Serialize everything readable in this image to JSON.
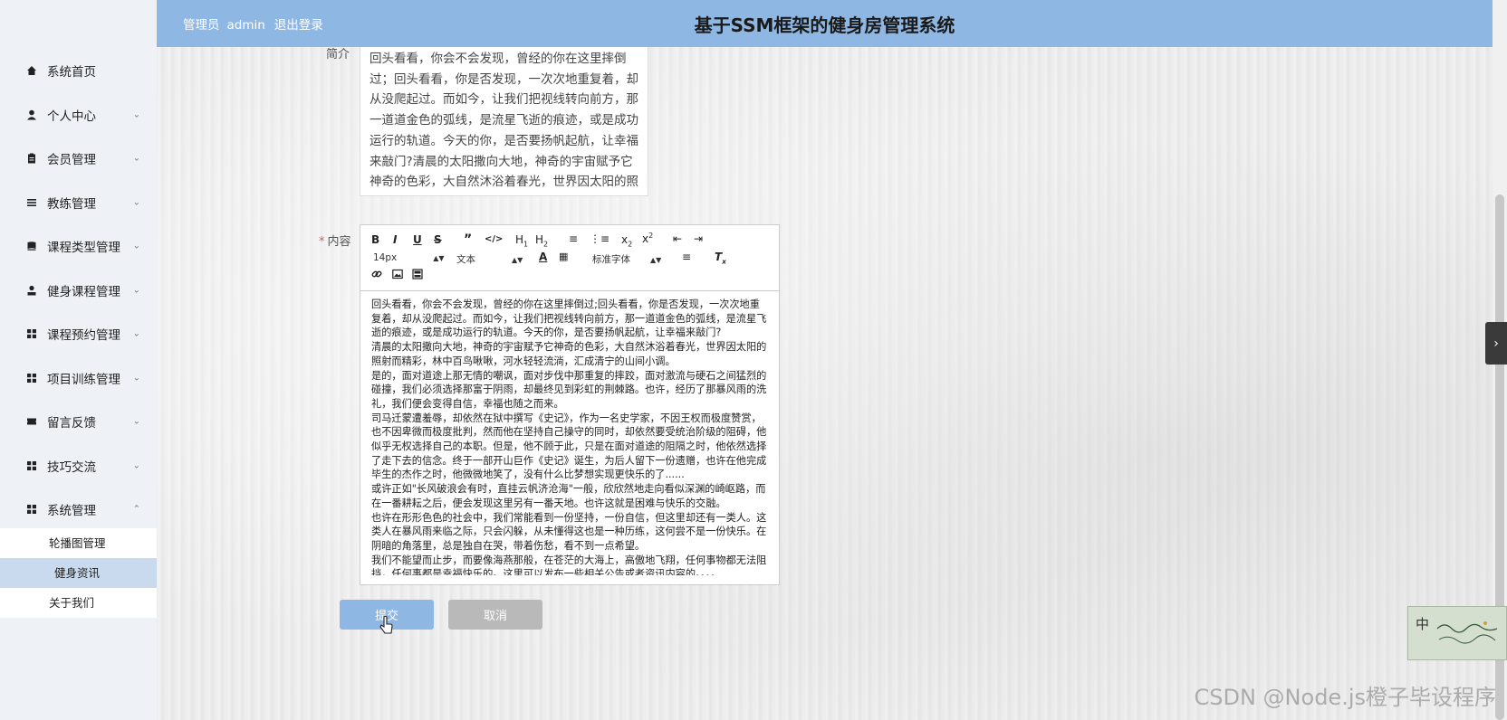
{
  "header": {
    "role": "管理员",
    "username": "admin",
    "logout": "退出登录",
    "title": "基于SSM框架的健身房管理系统"
  },
  "sidebar": {
    "items": [
      {
        "label": "系统首页",
        "icon": "home-icon"
      },
      {
        "label": "个人中心",
        "icon": "user-icon"
      },
      {
        "label": "会员管理",
        "icon": "clipboard-icon"
      },
      {
        "label": "教练管理",
        "icon": "list-icon"
      },
      {
        "label": "课程类型管理",
        "icon": "book-icon"
      },
      {
        "label": "健身课程管理",
        "icon": "user-icon"
      },
      {
        "label": "课程预约管理",
        "icon": "grid-icon"
      },
      {
        "label": "项目训练管理",
        "icon": "grid-icon"
      },
      {
        "label": "留言反馈",
        "icon": "ticket-icon"
      },
      {
        "label": "技巧交流",
        "icon": "grid-icon"
      },
      {
        "label": "系统管理",
        "icon": "grid-icon"
      }
    ],
    "submenu": [
      "轮播图管理",
      "健身资讯",
      "关于我们"
    ],
    "active_sub": "健身资讯"
  },
  "form": {
    "intro_label": "简介",
    "intro_text": "回头看看，你会不会发现，曾经的你在这里摔倒过；回头看看，你是否发现，一次次地重复着，却从没爬起过。而如今，让我们把视线转向前方，那一道道金色的弧线，是流星飞逝的痕迹，或是成功运行的轨道。今天的你，是否要扬帆起航，让幸福来敲门?清晨的太阳撒向大地，神奇的宇宙赋予它神奇的色彩，大自然沐浴着春光，世界因太阳的照射而精彩，林中百鸟啾啾，河水轻轻流淌，汇成清宁的山间小调。",
    "content_label": "内容",
    "toolbar": {
      "font_size": "14px",
      "text_type": "文本",
      "font_family": "标准字体"
    },
    "content": [
      "回头看看，你会不会发现，曾经的你在这里摔倒过;回头看看，你是否发现，一次次地重复着，却从没爬起过。而如今，让我们把视线转向前方，那一道道金色的弧线，是流星飞逝的痕迹，或是成功运行的轨道。今天的你，是否要扬帆起航，让幸福来敲门?",
      "清晨的太阳撒向大地，神奇的宇宙赋予它神奇的色彩，大自然沐浴着春光，世界因太阳的照射而精彩，林中百鸟啾啾，河水轻轻流淌，汇成清宁的山间小调。",
      "是的，面对道途上那无情的嘲讽，面对步伐中那重复的摔跤，面对激流与硬石之间猛烈的碰撞，我们必须选择那富于阴雨，却最终见到彩虹的荆棘路。也许，经历了那暴风雨的洗礼，我们便会变得自信，幸福也随之而来。",
      "司马迁蒙遭羞辱，却依然在狱中撰写《史记》，作为一名史学家，不因王权而极度赞赏，也不因卑微而极度批判，然而他在坚持自己操守的同时，却依然要受统治阶级的阻碍，他似乎无权选择自己的本职。但是，他不顾于此，只是在面对道途的阻隔之时，他依然选择了走下去的信念。终于一部开山巨作《史记》诞生，为后人留下一份遗赠，也许在他完成毕生的杰作之时，他微微地笑了，没有什么比梦想实现更快乐的了......",
      "或许正如\"长风破浪会有时，直挂云帆济沧海\"一般，欣欣然地走向看似深渊的崎岖路，而在一番耕耘之后，便会发现这里另有一番天地。也许这就是困难与快乐的交融。",
      "也许在形形色色的社会中，我们常能看到一份坚持，一份自信，但这里却还有一类人。这类人在暴风雨来临之际，只会闪躲，从未懂得这也是一种历练，这何尝不是一份快乐。在阴暗的角落里，总是独自在哭，带着伤愁，看不到一点希望。",
      "我们不能望而止步，而要像海燕那般，在苍茫的大海上，高傲地飞翔，任何事物都无法阻挡，任何事都是幸福快乐的。这里可以发布一些相关公告或者资讯内容的。。。。"
    ],
    "submit_label": "提交",
    "cancel_label": "取消"
  },
  "ime": {
    "char": "中"
  },
  "watermark": "CSDN @Node.js橙子毕设程序"
}
